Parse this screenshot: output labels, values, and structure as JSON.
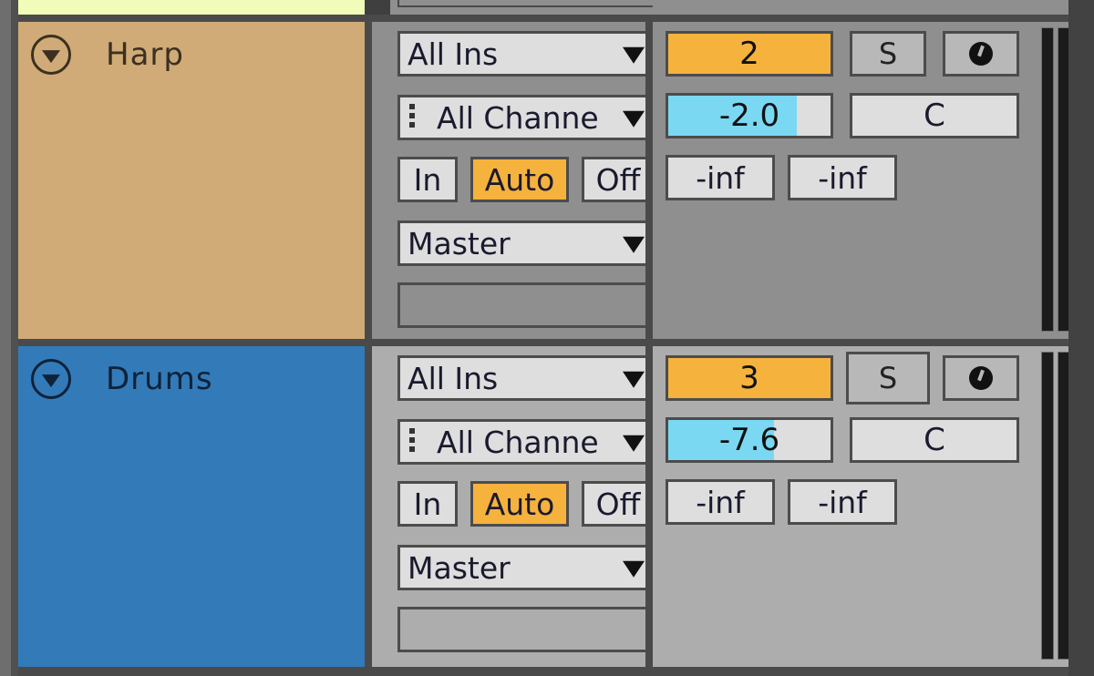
{
  "colors": {
    "prev_track": "#f0fcb8",
    "monitor_active": "#f5b23d",
    "track_number_bg": "#f5b23d",
    "volume_fill": "#7ad8f2"
  },
  "tracks": [
    {
      "name": "Harp",
      "color": "#d0ab78",
      "io_bg": "#8f8f8f",
      "mix_bg": "#8f8f8f",
      "name_color": "#3b3020",
      "input_type": "All Ins",
      "input_channel": "All Channels",
      "input_channel_display": "All Channe",
      "monitor": {
        "options": [
          "In",
          "Auto",
          "Off"
        ],
        "active": "Auto"
      },
      "output": "Master",
      "track_number": "2",
      "solo_label": "S",
      "solo_focused": false,
      "volume": "-2.0",
      "volume_fill_fraction": 0.79,
      "pan": "C",
      "peak_left": "-inf",
      "peak_right": "-inf"
    },
    {
      "name": "Drums",
      "color": "#337ab9",
      "io_bg": "#adadad",
      "mix_bg": "#adadad",
      "name_color": "#0e2238",
      "input_type": "All Ins",
      "input_channel": "All Channels",
      "input_channel_display": "All Channe",
      "monitor": {
        "options": [
          "In",
          "Auto",
          "Off"
        ],
        "active": "Auto"
      },
      "output": "Master",
      "track_number": "3",
      "solo_label": "S",
      "solo_focused": true,
      "volume": "-7.6",
      "volume_fill_fraction": 0.65,
      "pan": "C",
      "peak_left": "-inf",
      "peak_right": "-inf"
    }
  ]
}
